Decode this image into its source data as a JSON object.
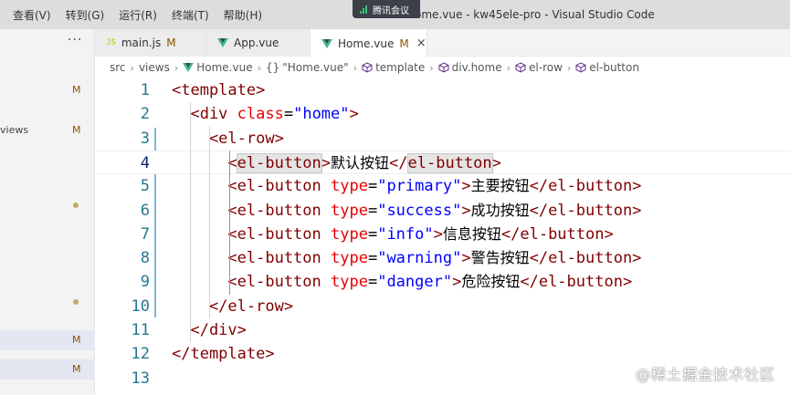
{
  "menu": [
    "查看(V)",
    "转到(G)",
    "运行(R)",
    "终端(T)",
    "帮助(H)"
  ],
  "window_title": "Home.vue - kw45ele-pro - Visual Studio Code",
  "meeting_badge": "腾讯会议",
  "sidebar": {
    "more": "···",
    "rows": [
      {
        "text": "",
        "status": "M",
        "dot": false
      },
      {
        "text": "views",
        "status": "M",
        "dot": false
      },
      {
        "text": "",
        "status": "",
        "dot": true
      },
      {
        "text": "",
        "status": "",
        "dot": true
      },
      {
        "text": "",
        "status": "M",
        "dot": false
      },
      {
        "text": "",
        "status": "M",
        "dot": false
      }
    ]
  },
  "tabs": [
    {
      "label": "main.js",
      "status": "M",
      "icon": "js-icon",
      "active": false
    },
    {
      "label": "App.vue",
      "status": "",
      "icon": "vue-icon",
      "active": false
    },
    {
      "label": "Home.vue",
      "status": "M",
      "icon": "vue-icon",
      "active": true
    }
  ],
  "tab_close": "×",
  "breadcrumb": [
    "src",
    "views",
    "Home.vue",
    "\"Home.vue\"",
    "template",
    "div.home",
    "el-row",
    "el-button"
  ],
  "breadcrumb_icons": [
    "",
    "",
    "vue-icon",
    "braces-icon",
    "element-icon",
    "element-icon",
    "element-icon",
    "element-icon"
  ],
  "code_lines": [
    {
      "n": "1",
      "segs": [
        [
          "t",
          "<template>"
        ]
      ]
    },
    {
      "n": "2",
      "segs": [
        [
          "t",
          "  <div "
        ],
        [
          "a",
          "class"
        ],
        [
          "p",
          "="
        ],
        [
          "s",
          "\"home\""
        ],
        [
          "t",
          ">"
        ]
      ]
    },
    {
      "n": "3",
      "segs": [
        [
          "t",
          "    <el-row>"
        ]
      ]
    },
    {
      "n": "4",
      "segs": [
        [
          "t",
          "      <"
        ],
        [
          "th",
          "el-button"
        ],
        [
          "t",
          ">"
        ],
        [
          "x",
          "默认按钮"
        ],
        [
          "t",
          "</"
        ],
        [
          "th",
          "el-button"
        ],
        [
          "t",
          ">"
        ]
      ]
    },
    {
      "n": "5",
      "segs": [
        [
          "t",
          "      <el-button "
        ],
        [
          "a",
          "type"
        ],
        [
          "p",
          "="
        ],
        [
          "s",
          "\"primary\""
        ],
        [
          "t",
          ">"
        ],
        [
          "x",
          "主要按钮"
        ],
        [
          "t",
          "</el-button>"
        ]
      ]
    },
    {
      "n": "6",
      "segs": [
        [
          "t",
          "      <el-button "
        ],
        [
          "a",
          "type"
        ],
        [
          "p",
          "="
        ],
        [
          "s",
          "\"success\""
        ],
        [
          "t",
          ">"
        ],
        [
          "x",
          "成功按钮"
        ],
        [
          "t",
          "</el-button>"
        ]
      ]
    },
    {
      "n": "7",
      "segs": [
        [
          "t",
          "      <el-button "
        ],
        [
          "a",
          "type"
        ],
        [
          "p",
          "="
        ],
        [
          "s",
          "\"info\""
        ],
        [
          "t",
          ">"
        ],
        [
          "x",
          "信息按钮"
        ],
        [
          "t",
          "</el-button>"
        ]
      ]
    },
    {
      "n": "8",
      "segs": [
        [
          "t",
          "      <el-button "
        ],
        [
          "a",
          "type"
        ],
        [
          "p",
          "="
        ],
        [
          "s",
          "\"warning\""
        ],
        [
          "t",
          ">"
        ],
        [
          "x",
          "警告按钮"
        ],
        [
          "t",
          "</el-button>"
        ]
      ]
    },
    {
      "n": "9",
      "segs": [
        [
          "t",
          "      <el-button "
        ],
        [
          "a",
          "type"
        ],
        [
          "p",
          "="
        ],
        [
          "s",
          "\"danger\""
        ],
        [
          "t",
          ">"
        ],
        [
          "x",
          "危险按钮"
        ],
        [
          "t",
          "</el-button>"
        ]
      ]
    },
    {
      "n": "10",
      "segs": [
        [
          "t",
          "    </el-row>"
        ]
      ]
    },
    {
      "n": "11",
      "segs": [
        [
          "t",
          "  </div>"
        ]
      ]
    },
    {
      "n": "12",
      "segs": [
        [
          "t",
          "</template>"
        ]
      ]
    },
    {
      "n": "13",
      "segs": []
    }
  ],
  "current_line": 4,
  "watermark": "@稀土掘金技术社区",
  "colors": {
    "tag": "#800000",
    "attribute": "#e50000",
    "string": "#0000ff",
    "line_number": "#237893",
    "modified": "#895503"
  }
}
